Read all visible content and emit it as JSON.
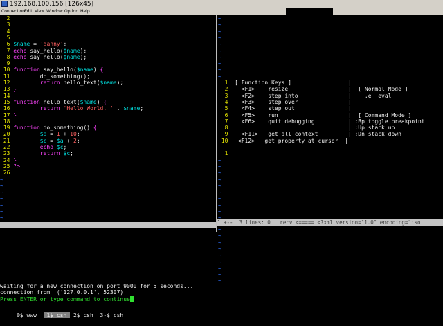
{
  "window": {
    "title": "192.168.100.156 [126x45]"
  },
  "menu": [
    "Connection",
    "Edit",
    "View",
    "Window",
    "Option",
    "Help"
  ],
  "left_pane": {
    "lines": [
      {
        "n": "2",
        "segs": []
      },
      {
        "n": "3",
        "segs": []
      },
      {
        "n": "4",
        "segs": []
      },
      {
        "n": "5",
        "segs": []
      },
      {
        "n": "6",
        "segs": [
          {
            "c": "var",
            "t": "$name"
          },
          {
            "c": "nt",
            "t": " = "
          },
          {
            "c": "str",
            "t": "'danny'"
          },
          {
            "c": "nt",
            "t": ";"
          }
        ]
      },
      {
        "n": "7",
        "segs": [
          {
            "c": "kw",
            "t": "echo"
          },
          {
            "c": "nt",
            "t": " say_hello("
          },
          {
            "c": "var",
            "t": "$name"
          },
          {
            "c": "nt",
            "t": ");"
          }
        ]
      },
      {
        "n": "8",
        "segs": [
          {
            "c": "kw",
            "t": "echo"
          },
          {
            "c": "nt",
            "t": " say_hello("
          },
          {
            "c": "var",
            "t": "$name"
          },
          {
            "c": "nt",
            "t": ");"
          }
        ]
      },
      {
        "n": "9",
        "segs": []
      },
      {
        "n": "10",
        "segs": [
          {
            "c": "kw",
            "t": "function"
          },
          {
            "c": "nt",
            "t": " say_hello("
          },
          {
            "c": "var",
            "t": "$name"
          },
          {
            "c": "nt",
            "t": ") "
          },
          {
            "c": "kw",
            "t": "{"
          }
        ]
      },
      {
        "n": "11",
        "segs": [
          {
            "c": "nt",
            "t": "        do_something();"
          }
        ]
      },
      {
        "n": "12",
        "segs": [
          {
            "c": "kw",
            "t": "        return"
          },
          {
            "c": "nt",
            "t": " hello_text("
          },
          {
            "c": "var",
            "t": "$name"
          },
          {
            "c": "nt",
            "t": ");"
          }
        ]
      },
      {
        "n": "13",
        "segs": [
          {
            "c": "kw",
            "t": "}"
          }
        ]
      },
      {
        "n": "14",
        "segs": []
      },
      {
        "n": "15",
        "segs": [
          {
            "c": "kw",
            "t": "function"
          },
          {
            "c": "nt",
            "t": " hello_text("
          },
          {
            "c": "var",
            "t": "$name"
          },
          {
            "c": "nt",
            "t": ") "
          },
          {
            "c": "kw",
            "t": "{"
          }
        ]
      },
      {
        "n": "16",
        "segs": [
          {
            "c": "kw",
            "t": "        return"
          },
          {
            "c": "nt",
            "t": " "
          },
          {
            "c": "str",
            "t": "'Hello World, '"
          },
          {
            "c": "nt",
            "t": " . "
          },
          {
            "c": "var",
            "t": "$name"
          },
          {
            "c": "nt",
            "t": ";"
          }
        ]
      },
      {
        "n": "17",
        "segs": [
          {
            "c": "kw",
            "t": "}"
          }
        ]
      },
      {
        "n": "18",
        "segs": []
      },
      {
        "n": "19",
        "segs": [
          {
            "c": "kw",
            "t": "function"
          },
          {
            "c": "nt",
            "t": " do_something() "
          },
          {
            "c": "kw",
            "t": "{"
          }
        ]
      },
      {
        "n": "20",
        "segs": [
          {
            "c": "var",
            "t": "        $a"
          },
          {
            "c": "nt",
            "t": " = "
          },
          {
            "c": "str",
            "t": "1"
          },
          {
            "c": "nt",
            "t": " + "
          },
          {
            "c": "str",
            "t": "10"
          },
          {
            "c": "nt",
            "t": ";"
          }
        ]
      },
      {
        "n": "21",
        "segs": [
          {
            "c": "var",
            "t": "        $c"
          },
          {
            "c": "nt",
            "t": " = "
          },
          {
            "c": "var",
            "t": "$a"
          },
          {
            "c": "nt",
            "t": " + "
          },
          {
            "c": "str",
            "t": "2"
          },
          {
            "c": "nt",
            "t": ";"
          }
        ]
      },
      {
        "n": "22",
        "segs": [
          {
            "c": "kw",
            "t": "        echo"
          },
          {
            "c": "nt",
            "t": " "
          },
          {
            "c": "var",
            "t": "$c"
          },
          {
            "c": "nt",
            "t": ";"
          }
        ]
      },
      {
        "n": "23",
        "segs": [
          {
            "c": "kw",
            "t": "        return"
          },
          {
            "c": "nt",
            "t": " "
          },
          {
            "c": "var",
            "t": "$c"
          },
          {
            "c": "nt",
            "t": ";"
          }
        ]
      },
      {
        "n": "24",
        "segs": [
          {
            "c": "kw",
            "t": "}"
          }
        ]
      },
      {
        "n": "25",
        "segs": [
          {
            "c": "kw",
            "t": "?>"
          }
        ]
      },
      {
        "n": "26",
        "segs": []
      }
    ],
    "tilde": "~"
  },
  "right_pane": {
    "top_lines": [
      {
        "n": "1",
        "t": " [ Function Keys ]                 |"
      },
      {
        "n": "2",
        "t": "   <F1>    resize                  |  [ Normal Mode ]"
      },
      {
        "n": "3",
        "t": "   <F2>    step into               |    ,e  eval"
      },
      {
        "n": "4",
        "t": "   <F3>    step over               |"
      },
      {
        "n": "5",
        "t": "   <F4>    step out                |"
      },
      {
        "n": "6",
        "t": "   <F5>    run                     |  [ Command Mode ]"
      },
      {
        "n": "7",
        "t": "   <F6>    quit debugging          | :Bp toggle breakpoint"
      },
      {
        "n": "8",
        "t": "                                   | :Up stack up"
      },
      {
        "n": "9",
        "t": "   <F11>   get all context         | :Dn stack down"
      },
      {
        "n": "10",
        "t": "  <F12>   get property at cursor  |"
      }
    ],
    "top_extra": {
      "n": "1",
      "t": ""
    },
    "status": "1 +--  3 lines: 0 : recv <===== <?xml version=\"1.0\" encoding=\"iso",
    "tilde": "~"
  },
  "console": {
    "line1": "waiting for a new connection on port 9000 for 5 seconds...",
    "line2": "connection from  ('127.0.0.1', 52307)",
    "prompt": "Press ENTER or type command to continue"
  },
  "screen_bar": {
    "items": [
      {
        "t": " 0$ www  ",
        "cur": false
      },
      {
        "t": " 1$ csh ",
        "cur": true
      },
      {
        "t": " 2$ csh  ",
        "cur": false
      },
      {
        "t": "3-$ csh",
        "cur": false
      }
    ]
  },
  "colors": {
    "background": "#000000",
    "line_number": "#e5e500",
    "keyword": "#ff44ff",
    "string": "#ff6060",
    "variable": "#00e0e0",
    "tilde": "#3070ff",
    "prompt": "#30e030"
  }
}
